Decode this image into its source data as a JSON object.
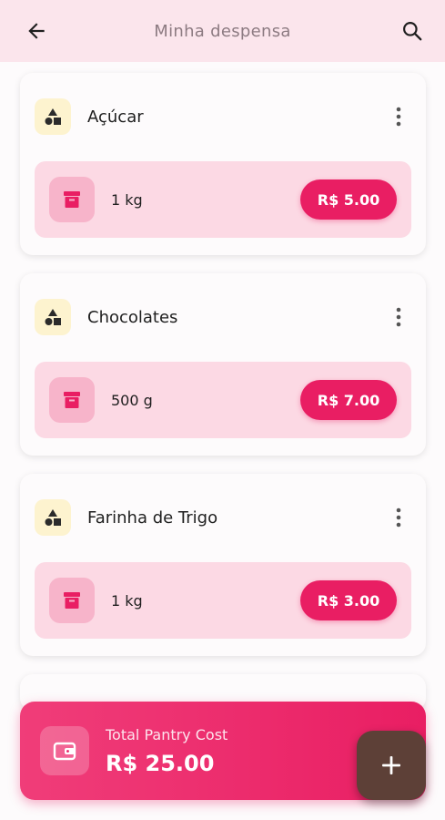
{
  "header": {
    "title": "Minha despensa",
    "back_icon": "arrow-back-icon",
    "search_icon": "search-icon"
  },
  "items": [
    {
      "name": "Açúcar",
      "quantity": "1 kg",
      "price": "R$ 5.00"
    },
    {
      "name": "Chocolates",
      "quantity": "500 g",
      "price": "R$ 7.00"
    },
    {
      "name": "Farinha de Trigo",
      "quantity": "1 kg",
      "price": "R$ 3.00"
    }
  ],
  "total": {
    "label": "Total Pantry Cost",
    "value": "R$ 25.00",
    "icon": "wallet-icon"
  },
  "fab": {
    "icon": "plus-icon"
  },
  "colors": {
    "appbar": "#fbe5ec",
    "accent": "#e91e63",
    "item_row": "#fcd9e4",
    "category_icon_bg": "#fdf3cf",
    "fab": "#5d4037"
  }
}
